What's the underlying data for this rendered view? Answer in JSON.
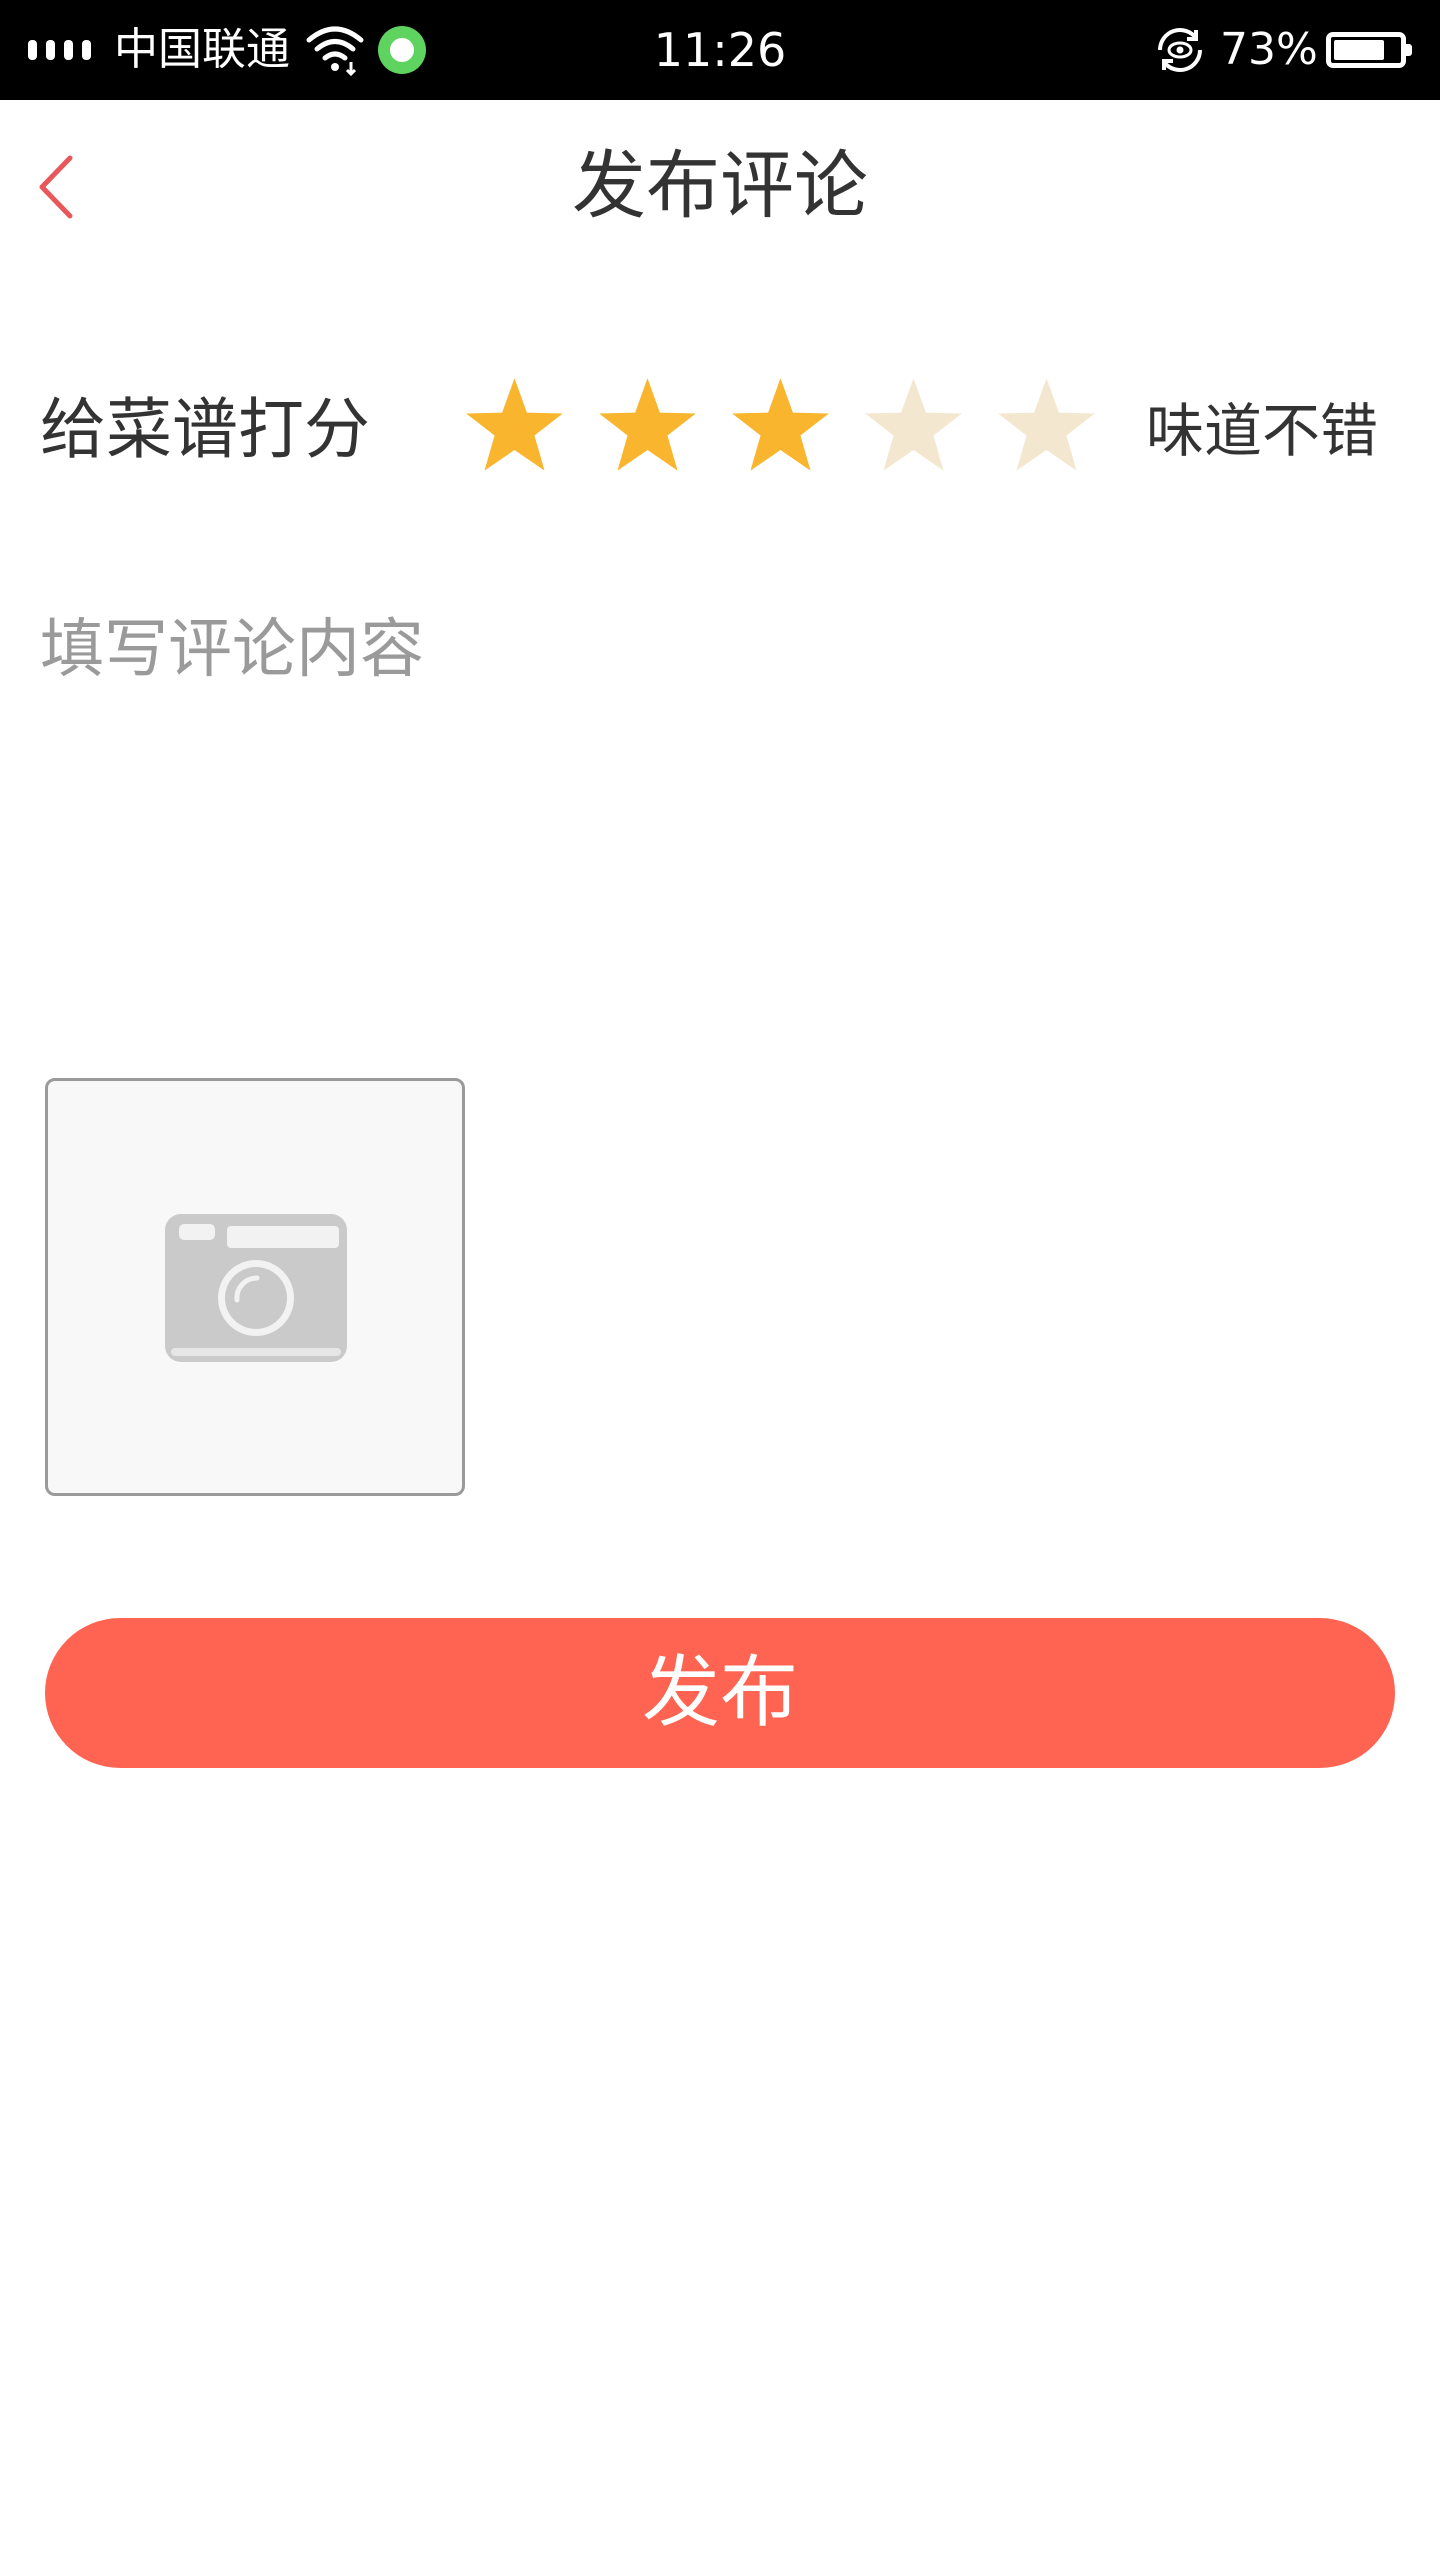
{
  "status_bar": {
    "carrier": "中国联通",
    "time": "11:26",
    "battery_percent": "73%",
    "battery_level": 0.73,
    "icons": [
      "signal-icon",
      "wifi-icon",
      "message-app-icon",
      "rotation-lock-icon",
      "battery-icon"
    ]
  },
  "header": {
    "title": "发布评论",
    "back_icon": "chevron-left-icon"
  },
  "rating": {
    "label": "给菜谱打分",
    "value": 3,
    "max": 5,
    "text": "味道不错"
  },
  "comment": {
    "placeholder": "填写评论内容",
    "value": ""
  },
  "photo": {
    "icon": "camera-icon"
  },
  "publish": {
    "label": "发布"
  },
  "colors": {
    "accent": "#ff6452",
    "back_arrow": "#e8585a",
    "star_filled": "#f8b52d",
    "star_empty": "#f4e7d0",
    "placeholder": "#9a9a9a",
    "status_bar": "#000000"
  }
}
